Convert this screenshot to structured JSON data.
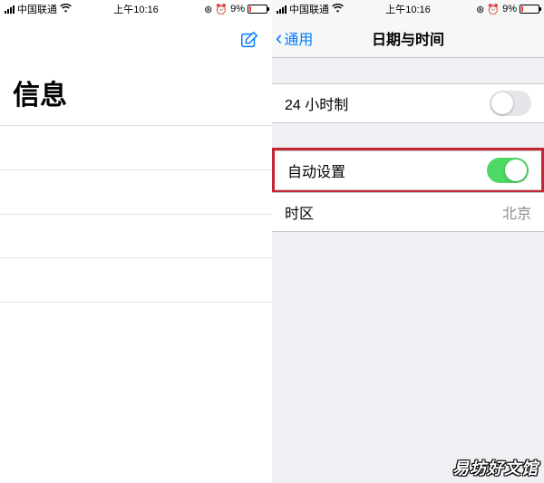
{
  "status": {
    "carrier": "中国联通",
    "time": "上午10:16",
    "battery_percent": "9%"
  },
  "left": {
    "title": "信息"
  },
  "right": {
    "back_label": "通用",
    "nav_title": "日期与时间",
    "cells": {
      "hour24": {
        "label": "24 小时制",
        "on": false
      },
      "auto_set": {
        "label": "自动设置",
        "on": true
      },
      "timezone": {
        "label": "时区",
        "value": "北京"
      }
    }
  },
  "watermark": "易坊好文馆"
}
